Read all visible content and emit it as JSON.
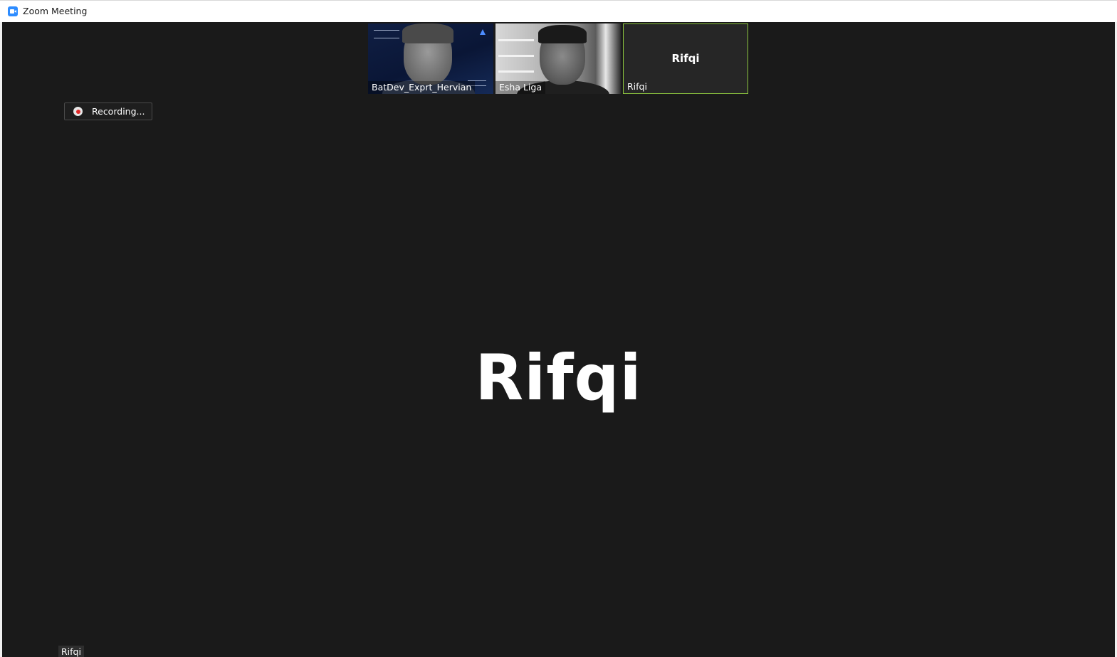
{
  "window": {
    "title": "Zoom Meeting"
  },
  "thumbnails": [
    {
      "name": "BatDev_Exprt_Hervian",
      "has_video": true
    },
    {
      "name": "Esha Liga",
      "has_video": true
    },
    {
      "name": "Rifqi",
      "has_video": false,
      "center_label": "Rifqi",
      "active_speaker": true
    }
  ],
  "recording": {
    "label": "Recording..."
  },
  "main_view": {
    "speaker_name": "Rifqi",
    "name_tag": "Rifqi"
  },
  "colors": {
    "meeting_bg": "#1a1a1a",
    "active_speaker_border": "#8dc63f",
    "recording_dot": "#e02828",
    "app_icon": "#2d8cff"
  }
}
